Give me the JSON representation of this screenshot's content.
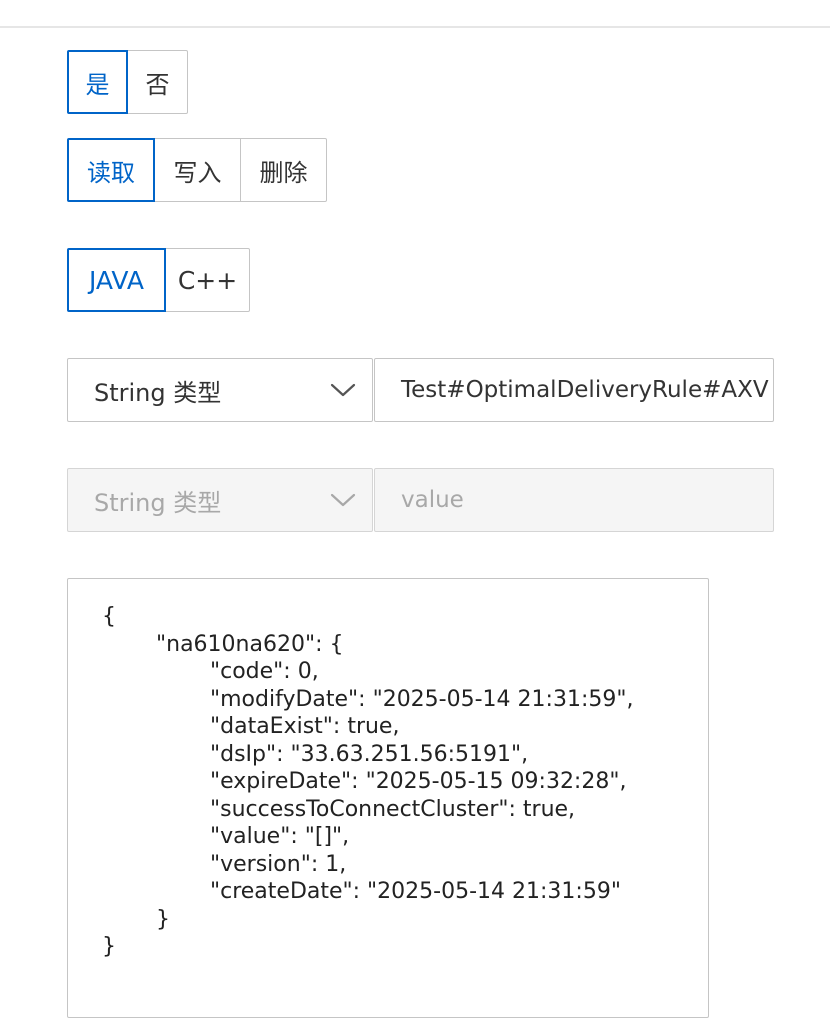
{
  "yes_no": {
    "options": [
      "是",
      "否"
    ],
    "selected": "是"
  },
  "operation": {
    "options": [
      "读取",
      "写入",
      "删除"
    ],
    "selected": "读取"
  },
  "language": {
    "options": [
      "JAVA",
      "C++"
    ],
    "selected": "JAVA"
  },
  "key_row": {
    "type_select": "String 类型",
    "key_value": "Test#OptimalDeliveryRule#AXV"
  },
  "value_row": {
    "type_select": "String 类型",
    "value_placeholder": "value"
  },
  "result": {
    "lines": [
      "{",
      "\"na610na620\": {",
      "\"code\": 0,",
      "\"modifyDate\": \"2025-05-14 21:31:59\",",
      "\"dataExist\": true,",
      "\"dsIp\": \"33.63.251.56:5191\",",
      "\"expireDate\": \"2025-05-15 09:32:28\",",
      "\"successToConnectCluster\": true,",
      "\"value\": \"[]\",",
      "\"version\": 1,",
      "\"createDate\": \"2025-05-14 21:31:59\"",
      "}",
      "}"
    ]
  },
  "colors": {
    "accent": "#0064c8",
    "border": "#c5c5c5",
    "disabled_bg": "#f5f5f5"
  }
}
